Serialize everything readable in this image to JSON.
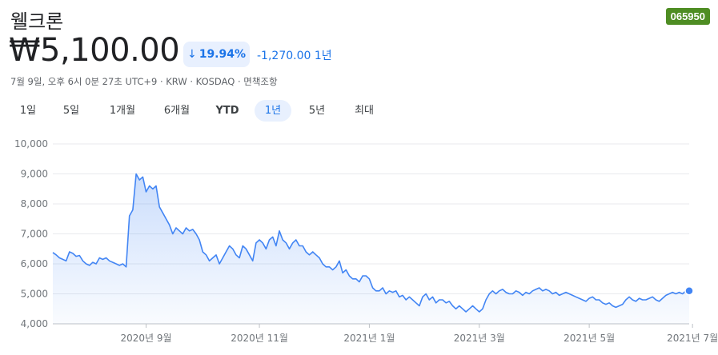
{
  "header": {
    "title": "웰크론",
    "ticker": "065950",
    "price": "₩5,100.00",
    "change_pct": "19.94%",
    "change_abs": "-1,270.00 1년",
    "meta": "7월 9일, 오후 6시 0분 27초 UTC+9 · KRW · KOSDAQ · 면책조항"
  },
  "colors": {
    "line": "#4285f4",
    "accent": "#1a73e8",
    "badge": "#4e8d23"
  },
  "tabs": [
    {
      "label": "1일",
      "active": false
    },
    {
      "label": "5일",
      "active": false
    },
    {
      "label": "1개월",
      "active": false
    },
    {
      "label": "6개월",
      "active": false
    },
    {
      "label": "YTD",
      "active": false
    },
    {
      "label": "1년",
      "active": true
    },
    {
      "label": "5년",
      "active": false
    },
    {
      "label": "최대",
      "active": false
    }
  ],
  "chart_data": {
    "type": "area",
    "ylim": [
      4000,
      10000
    ],
    "yticks": [
      "10,000",
      "9,000",
      "8,000",
      "7,000",
      "6,000",
      "5,000",
      "4,000"
    ],
    "ytick_values": [
      10000,
      9000,
      8000,
      7000,
      6000,
      5000,
      4000
    ],
    "xticks": [
      "2020년 9월",
      "2020년 11월",
      "2021년 1월",
      "2021년 3월",
      "2021년 5월",
      "2021년 7월"
    ],
    "xtick_index": [
      28,
      62,
      95,
      128,
      161,
      192
    ],
    "values": [
      6380,
      6300,
      6200,
      6150,
      6100,
      6400,
      6350,
      6250,
      6280,
      6100,
      6000,
      5950,
      6050,
      6000,
      6200,
      6150,
      6200,
      6100,
      6050,
      6000,
      5950,
      6000,
      5900,
      7600,
      7800,
      9000,
      8800,
      8900,
      8400,
      8600,
      8500,
      8600,
      7900,
      7700,
      7500,
      7300,
      7000,
      7200,
      7100,
      7000,
      7200,
      7100,
      7150,
      7000,
      6800,
      6400,
      6300,
      6100,
      6200,
      6300,
      6000,
      6200,
      6400,
      6600,
      6500,
      6300,
      6200,
      6600,
      6500,
      6300,
      6100,
      6700,
      6800,
      6700,
      6500,
      6800,
      6900,
      6600,
      7100,
      6800,
      6700,
      6500,
      6700,
      6800,
      6600,
      6600,
      6400,
      6300,
      6400,
      6300,
      6200,
      6000,
      5900,
      5900,
      5800,
      5900,
      6100,
      5700,
      5800,
      5600,
      5500,
      5500,
      5400,
      5600,
      5600,
      5500,
      5200,
      5100,
      5100,
      5200,
      5000,
      5100,
      5050,
      5100,
      4900,
      4950,
      4800,
      4900,
      4800,
      4700,
      4600,
      4900,
      5000,
      4800,
      4900,
      4700,
      4800,
      4800,
      4700,
      4750,
      4600,
      4500,
      4600,
      4500,
      4400,
      4500,
      4600,
      4500,
      4400,
      4500,
      4800,
      5000,
      5100,
      5000,
      5100,
      5150,
      5050,
      5000,
      5000,
      5100,
      5050,
      4950,
      5050,
      5000,
      5100,
      5150,
      5200,
      5100,
      5150,
      5100,
      5000,
      5050,
      4950,
      5000,
      5050,
      5000,
      4950,
      4900,
      4850,
      4800,
      4750,
      4850,
      4900,
      4800,
      4800,
      4700,
      4650,
      4700,
      4600,
      4550,
      4600,
      4650,
      4800,
      4900,
      4800,
      4750,
      4850,
      4800,
      4800,
      4850,
      4900,
      4800,
      4750,
      4850,
      4950,
      5000,
      5050,
      5000,
      5050,
      5000,
      5100,
      5100
    ]
  }
}
